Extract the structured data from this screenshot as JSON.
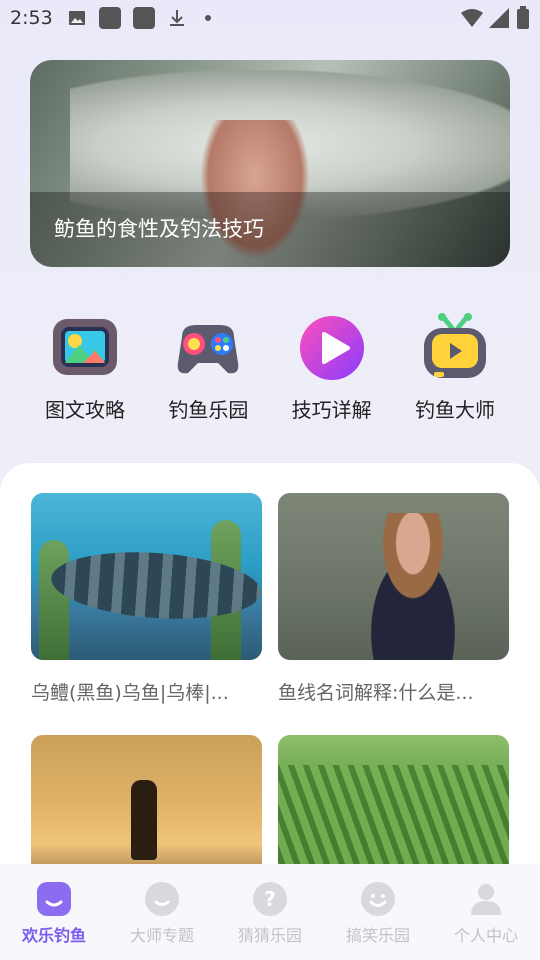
{
  "status_bar": {
    "time": "2:53",
    "icons": [
      "image-icon",
      "app-square-icon",
      "app-square-icon",
      "download-icon",
      "dot-icon"
    ],
    "right_icons": [
      "wifi-icon",
      "signal-icon",
      "battery-icon"
    ]
  },
  "banner": {
    "title": "鲂鱼的食性及钓法技巧"
  },
  "quick_nav": [
    {
      "label": "图文攻略",
      "icon": "picture-tv-icon"
    },
    {
      "label": "钓鱼乐园",
      "icon": "gamepad-icon"
    },
    {
      "label": "技巧详解",
      "icon": "play-circle-icon"
    },
    {
      "label": "钓鱼大师",
      "icon": "retro-tv-icon"
    }
  ],
  "articles": [
    {
      "caption": "乌鳢(黑鱼)乌鱼|乌棒|..."
    },
    {
      "caption": "鱼线名词解释:什么是..."
    },
    {
      "caption": ""
    },
    {
      "caption": ""
    }
  ],
  "bottom_nav": [
    {
      "label": "欢乐钓鱼",
      "active": true
    },
    {
      "label": "大师专题",
      "active": false
    },
    {
      "label": "猜猜乐园",
      "active": false
    },
    {
      "label": "搞笑乐园",
      "active": false
    },
    {
      "label": "个人中心",
      "active": false
    }
  ],
  "colors": {
    "accent": "#7b5cf0",
    "inactive": "#c2c2c8",
    "background": "#ececf9"
  }
}
